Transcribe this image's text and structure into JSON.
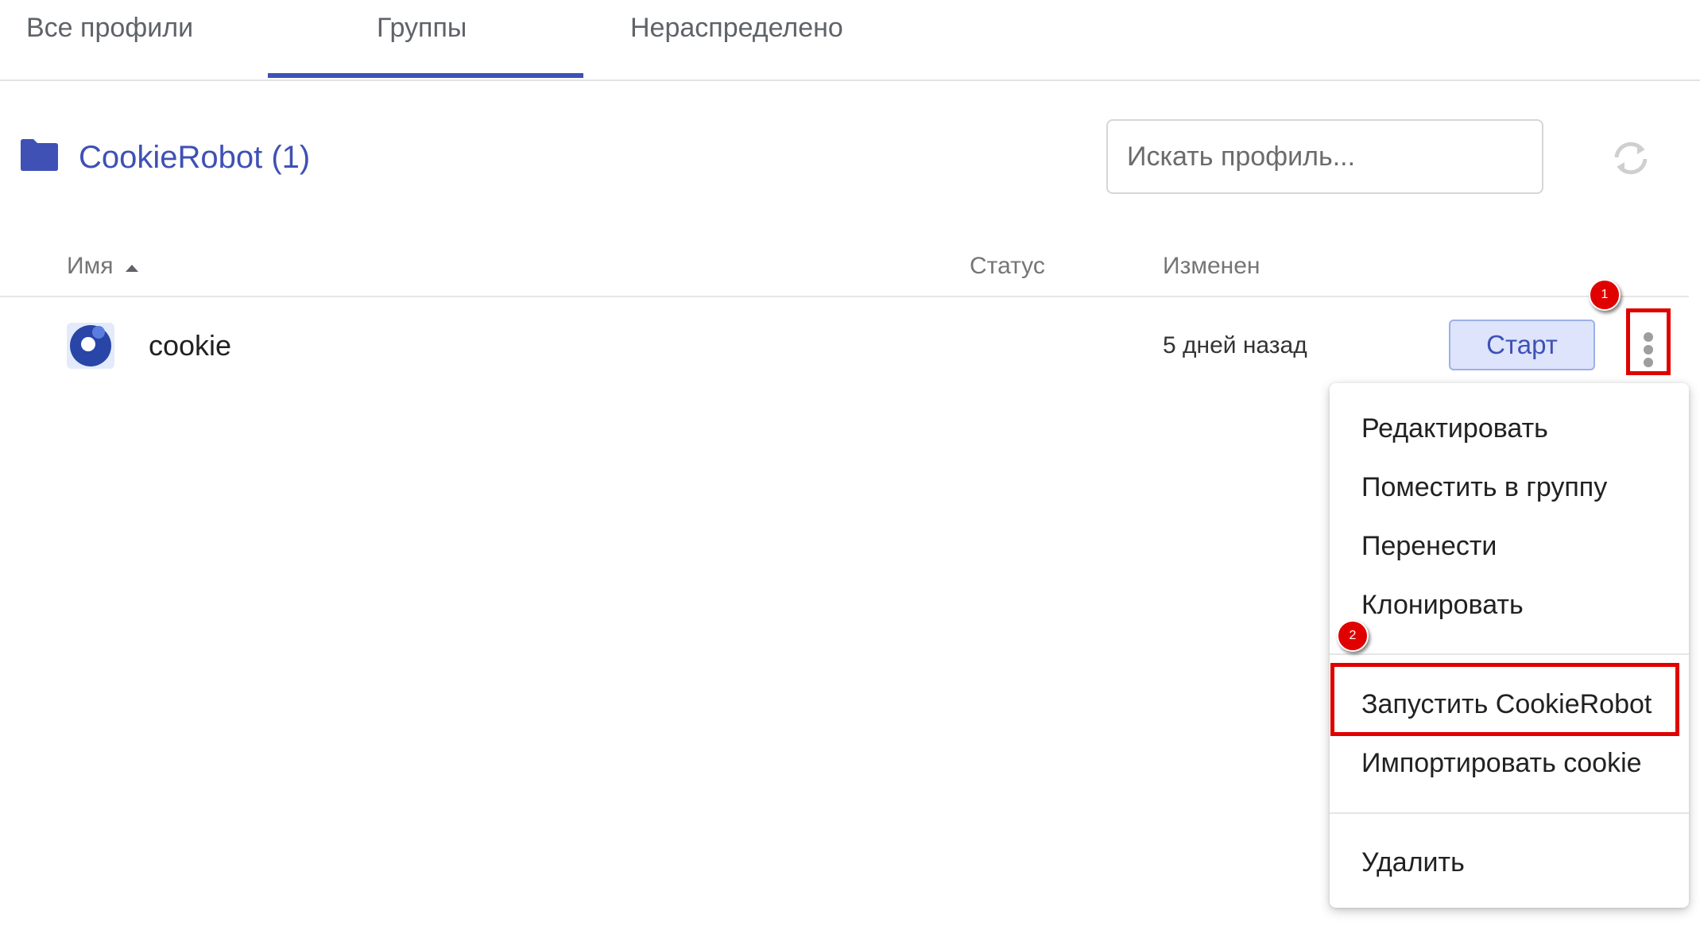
{
  "tabs": [
    {
      "label": "Все профили"
    },
    {
      "label": "Группы",
      "active": true
    },
    {
      "label": "Нераспределено"
    }
  ],
  "group": {
    "title": "CookieRobot (1)"
  },
  "search": {
    "placeholder": "Искать профиль..."
  },
  "table": {
    "columns": {
      "name": "Имя",
      "status": "Статус",
      "modified": "Изменен"
    },
    "rows": [
      {
        "name": "cookie",
        "status": "",
        "modified": "5 дней назад",
        "start_label": "Старт"
      }
    ]
  },
  "menu": {
    "items": [
      {
        "label": "Редактировать"
      },
      {
        "label": "Поместить в группу"
      },
      {
        "label": "Перенести"
      },
      {
        "label": "Клонировать"
      },
      {
        "label": "Запустить CookieRobot",
        "highlighted": true
      },
      {
        "label": "Импортировать cookie"
      },
      {
        "label": "Удалить"
      }
    ]
  },
  "markers": [
    "1",
    "2"
  ],
  "icons": {
    "folder": "folder-icon",
    "refresh": "refresh-icon",
    "sort": "sort-ascending-icon",
    "kebab": "more-vertical-icon",
    "avatar": "browser-profile-icon"
  },
  "colors": {
    "accent": "#3f51b5",
    "annotation": "#e00000",
    "start_button_bg": "#dde4fb"
  }
}
